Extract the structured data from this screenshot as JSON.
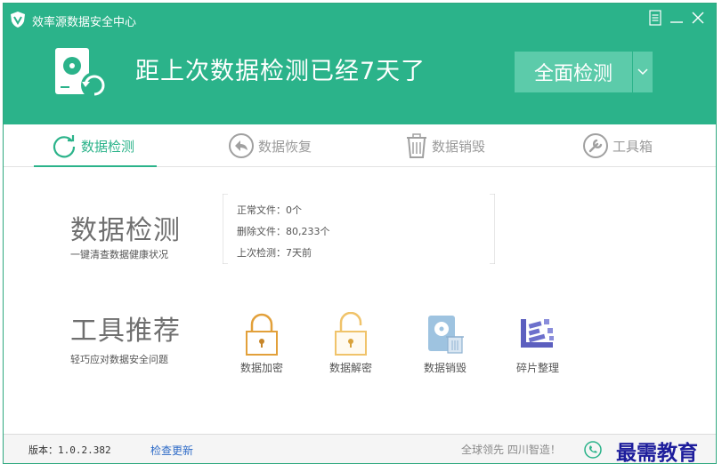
{
  "window": {
    "title": "效率源数据安全中心"
  },
  "header": {
    "headline": "距上次数据检测已经7天了",
    "scan_button": "全面检测"
  },
  "tabs": [
    {
      "label": "数据检测",
      "icon": "refresh-circle-icon",
      "active": true
    },
    {
      "label": "数据恢复",
      "icon": "back-arrow-icon",
      "active": false
    },
    {
      "label": "数据销毁",
      "icon": "trash-icon",
      "active": false
    },
    {
      "label": "工具箱",
      "icon": "wrench-icon",
      "active": false
    }
  ],
  "detect": {
    "title": "数据检测",
    "subtitle": "一键清查数据健康状况",
    "lines": [
      "正常文件：0个",
      "删除文件：80,233个",
      "上次检测：7天前"
    ]
  },
  "tools": {
    "title": "工具推荐",
    "subtitle": "轻巧应对数据安全问题",
    "items": [
      {
        "label": "数据加密",
        "icon": "lock-icon"
      },
      {
        "label": "数据解密",
        "icon": "unlock-icon"
      },
      {
        "label": "数据销毁",
        "icon": "disk-destroy-icon"
      },
      {
        "label": "碎片整理",
        "icon": "defrag-icon"
      }
    ]
  },
  "footer": {
    "version": "版本：1.0.2.382",
    "update_link": "检查更新",
    "slogan": "全球领先 四川智造！"
  },
  "watermark": "最需教育",
  "colors": {
    "brand": "#2bb38a",
    "button": "#5ccbaa",
    "link": "#2e6bc7"
  }
}
